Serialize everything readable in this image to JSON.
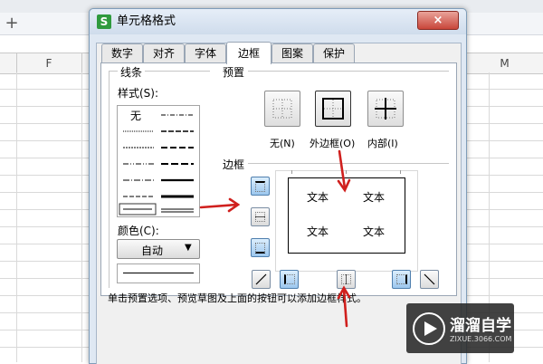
{
  "spreadsheet": {
    "add_sheet": "+",
    "col_f": "F",
    "col_m": "M"
  },
  "dialog": {
    "title": "单元格格式",
    "close": "×",
    "tabs": [
      "数字",
      "对齐",
      "字体",
      "边框",
      "图案",
      "保护"
    ],
    "active_tab": "边框",
    "line_group": "线条",
    "style_label": "样式(S):",
    "style_none": "无",
    "color_label": "颜色(C):",
    "color_value": "自动",
    "preset_group": "预置",
    "preset_none": "无(N)",
    "preset_outline": "外边框(O)",
    "preset_inside": "内部(I)",
    "border_group": "边框",
    "preview_text": "文本",
    "hint": "单击预置选项、预览草图及上面的按钮可以添加边框样式。"
  },
  "colors": {
    "arrow": "#d0201e",
    "dialog_bg": "#dfe8f3",
    "toggle_on": "#9cc7ee"
  },
  "watermark": {
    "brand": "溜溜自学",
    "url": "ZIXUE.3066.COM"
  }
}
